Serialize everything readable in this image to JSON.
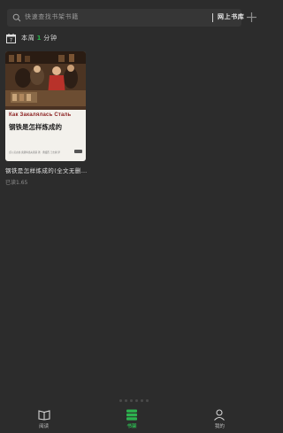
{
  "search": {
    "placeholder": "快速查找书架书籍",
    "online_store_label": "网上书库"
  },
  "weekly": {
    "prefix": "本周",
    "minutes": "1",
    "suffix": "分钟"
  },
  "books": [
    {
      "cover_title_ru": "Как Закалялась Сталь",
      "cover_title_cn": "钢铁是怎样炼成的",
      "cover_footer": "[苏] 尼古拉·奥斯特洛夫斯基 著 · 曹缦西 王志棣 译",
      "title": "钢铁是怎样炼成的(全文无删…",
      "progress": "已读1.65"
    }
  ],
  "nav": {
    "items": [
      {
        "label": "阅读",
        "icon": "book-open-icon",
        "active": false
      },
      {
        "label": "书架",
        "icon": "bookshelf-icon",
        "active": true
      },
      {
        "label": "我的",
        "icon": "person-icon",
        "active": false
      }
    ]
  },
  "colors": {
    "background": "#2c2c2c",
    "accent": "#29b34b",
    "search_bg": "#363636"
  }
}
